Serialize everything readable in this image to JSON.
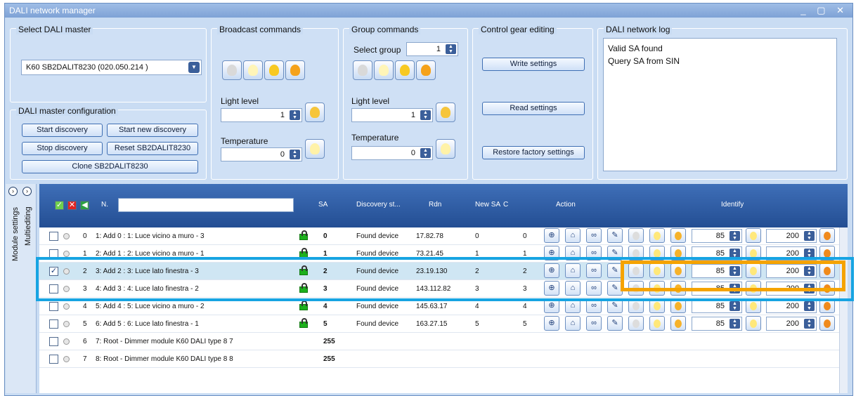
{
  "window": {
    "title": "DALI network manager",
    "controls": "_ ▢ ✕"
  },
  "master": {
    "label": "Select DALI master",
    "selected": "K60 SB2DALIT8230 (020.050.214 )"
  },
  "config": {
    "label": "DALI master configuration",
    "start_discovery": "Start discovery",
    "start_new_discovery": "Start new discovery",
    "stop_discovery": "Stop discovery",
    "reset": "Reset SB2DALIT8230",
    "clone": "Clone SB2DALIT8230"
  },
  "broadcast": {
    "label": "Broadcast commands",
    "light_level_label": "Light level",
    "light_level": "1",
    "temperature_label": "Temperature",
    "temperature": "0"
  },
  "group": {
    "label": "Group commands",
    "select_group_label": "Select group",
    "select_group": "1",
    "light_level_label": "Light level",
    "light_level": "1",
    "temperature_label": "Temperature",
    "temperature": "0"
  },
  "gear": {
    "label": "Control gear editing",
    "write": "Write settings",
    "read": "Read settings",
    "restore": "Restore factory settings"
  },
  "log": {
    "label": "DALI network log",
    "lines": [
      "Valid SA found",
      "Query SA from SIN"
    ]
  },
  "side": {
    "module_settings": "Module settings",
    "multiediting": "Multiediting"
  },
  "grid": {
    "headers": {
      "n": "N.",
      "sa": "SA",
      "discovery": "Discovery st...",
      "rdn": "Rdn",
      "new_sa": "New SA",
      "c": "C",
      "action": "Action",
      "identify": "Identify"
    },
    "rows": [
      {
        "n": "0",
        "name": "1: Add 0 : 1: Luce vicino a muro - 3",
        "sa": "0",
        "status": "Found device",
        "rdn": "17.82.78",
        "new_sa": "0",
        "c": "0",
        "level": "85",
        "temp": "200"
      },
      {
        "n": "1",
        "name": "2: Add 1 : 2: Luce vicino a muro - 1",
        "sa": "1",
        "status": "Found device",
        "rdn": "73.21.45",
        "new_sa": "1",
        "c": "1",
        "level": "85",
        "temp": "200"
      },
      {
        "n": "2",
        "name": "3: Add 2 : 3: Luce lato finestra  - 3",
        "sa": "2",
        "status": "Found device",
        "rdn": "23.19.130",
        "new_sa": "2",
        "c": "2",
        "level": "85",
        "temp": "200"
      },
      {
        "n": "3",
        "name": "4: Add 3 : 4: Luce lato finestra - 2",
        "sa": "3",
        "status": "Found device",
        "rdn": "143.112.82",
        "new_sa": "3",
        "c": "3",
        "level": "85",
        "temp": "200"
      },
      {
        "n": "4",
        "name": "5: Add 4 : 5: Luce vicino a muro - 2",
        "sa": "4",
        "status": "Found device",
        "rdn": "145.63.17",
        "new_sa": "4",
        "c": "4",
        "level": "85",
        "temp": "200"
      },
      {
        "n": "5",
        "name": "6: Add 5 : 6: Luce lato finestra  - 1",
        "sa": "5",
        "status": "Found device",
        "rdn": "163.27.15",
        "new_sa": "5",
        "c": "5",
        "level": "85",
        "temp": "200"
      },
      {
        "n": "6",
        "name": "7: Root - Dimmer module K60  DALI type 8 7",
        "sa": "255",
        "status": "",
        "rdn": "",
        "new_sa": "",
        "c": "",
        "level": "",
        "temp": ""
      },
      {
        "n": "7",
        "name": "8: Root - Dimmer module K60  DALI type 8 8",
        "sa": "255",
        "status": "",
        "rdn": "",
        "new_sa": "",
        "c": "",
        "level": "",
        "temp": ""
      }
    ]
  },
  "colors": {
    "highlight_blue": "#17a4e2",
    "highlight_orange": "#f5a300",
    "lock_green": "#1db01d"
  }
}
